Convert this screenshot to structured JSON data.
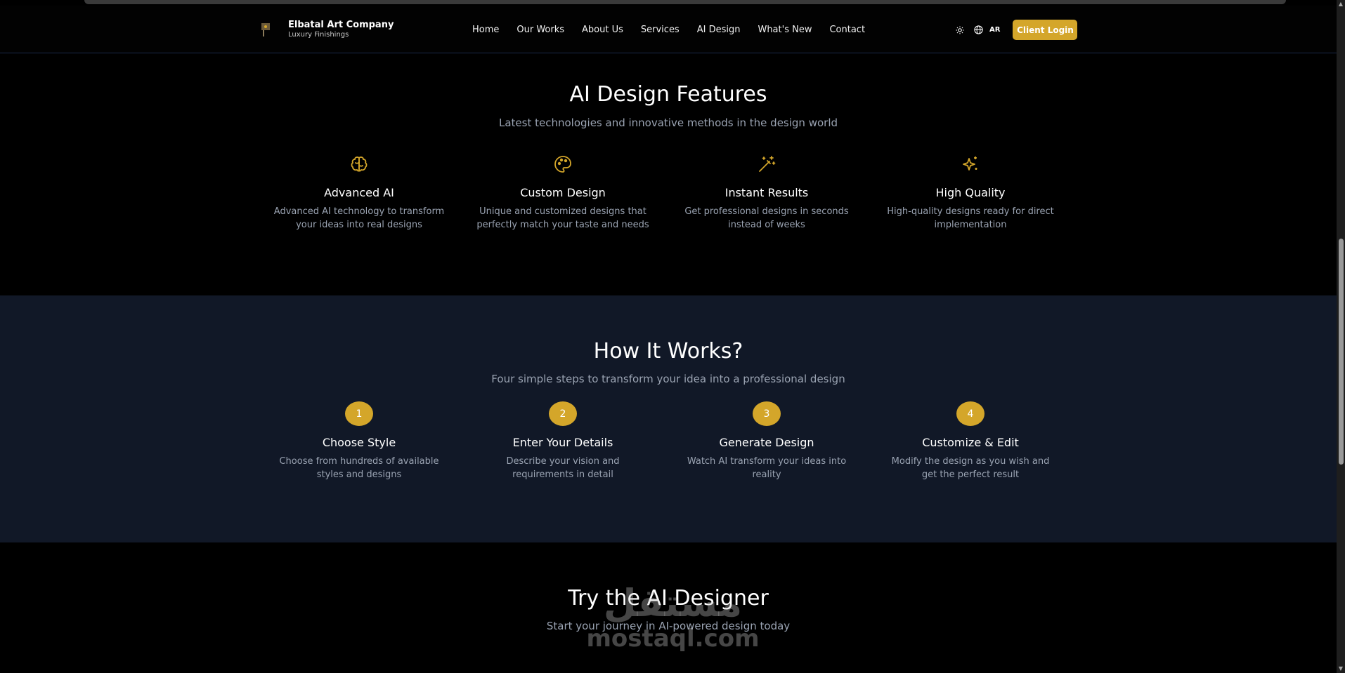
{
  "header": {
    "brand_name": "Elbatal Art Company",
    "brand_tagline": "Luxury Finishings",
    "nav": [
      "Home",
      "Our Works",
      "About Us",
      "Services",
      "AI Design",
      "What's New",
      "Contact"
    ],
    "lang_label": "AR",
    "login_label": "Client Login"
  },
  "features": {
    "title": "AI Design Features",
    "subtitle": "Latest technologies and innovative methods in the design world",
    "items": [
      {
        "icon": "brain-icon",
        "title": "Advanced AI",
        "desc": "Advanced AI technology to transform your ideas into real designs"
      },
      {
        "icon": "palette-icon",
        "title": "Custom Design",
        "desc": "Unique and customized designs that perfectly match your taste and needs"
      },
      {
        "icon": "magic-wand-icon",
        "title": "Instant Results",
        "desc": "Get professional designs in seconds instead of weeks"
      },
      {
        "icon": "sparkles-icon",
        "title": "High Quality",
        "desc": "High-quality designs ready for direct implementation"
      }
    ]
  },
  "how": {
    "title": "How It Works?",
    "subtitle": "Four simple steps to transform your idea into a professional design",
    "steps": [
      {
        "num": "1",
        "title": "Choose Style",
        "desc": "Choose from hundreds of available styles and designs"
      },
      {
        "num": "2",
        "title": "Enter Your Details",
        "desc": "Describe your vision and requirements in detail"
      },
      {
        "num": "3",
        "title": "Generate Design",
        "desc": "Watch AI transform your ideas into reality"
      },
      {
        "num": "4",
        "title": "Customize & Edit",
        "desc": "Modify the design as you wish and get the perfect result"
      }
    ]
  },
  "try": {
    "title": "Try the AI Designer",
    "subtitle": "Start your journey in AI-powered design today"
  },
  "watermark": {
    "arabic": "مستقل",
    "latin": "mostaql.com"
  },
  "colors": {
    "accent": "#d4a62a",
    "dark_section": "#111827",
    "muted_text": "#9aa3b2"
  }
}
